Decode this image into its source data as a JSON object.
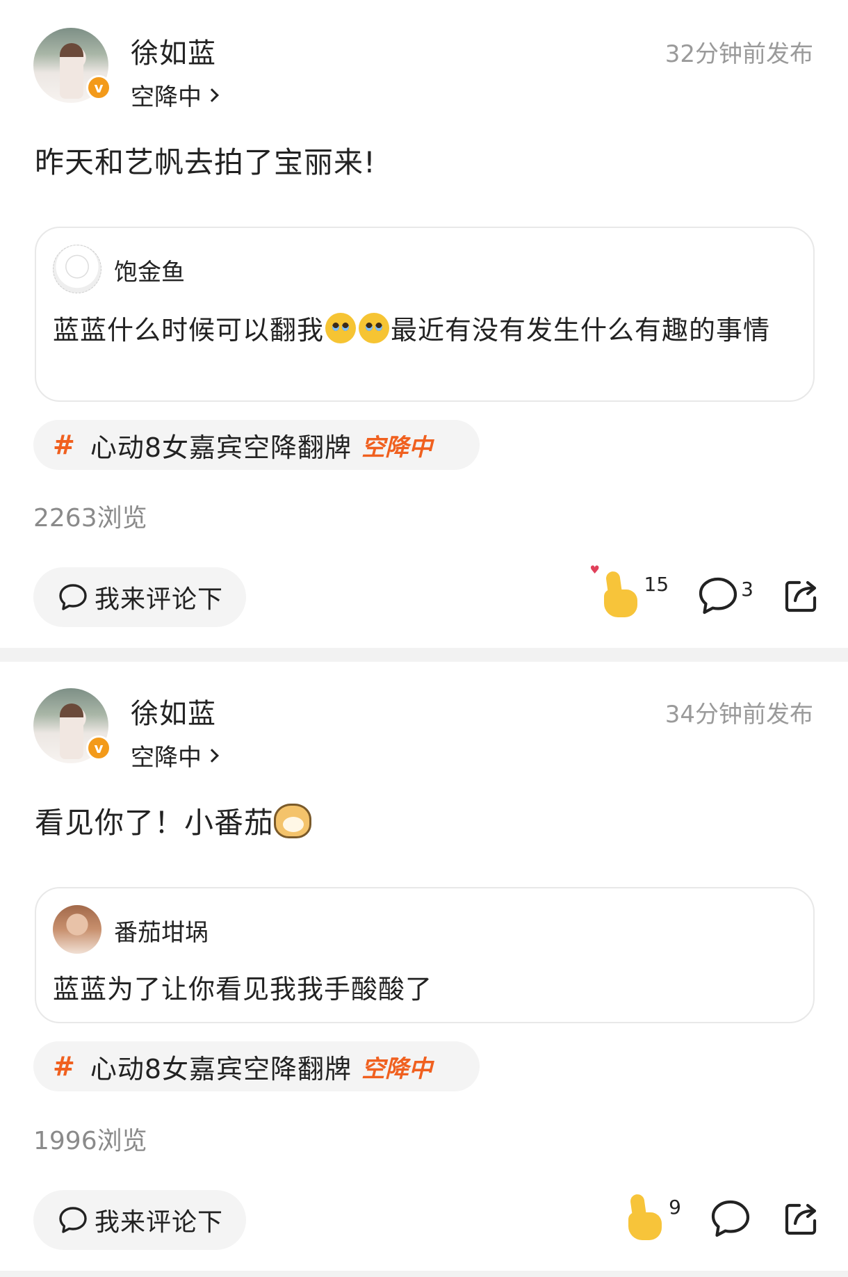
{
  "posts": [
    {
      "author": "徐如蓝",
      "status": "空降中",
      "timestamp": "32分钟前发布",
      "content": "昨天和艺帆去拍了宝丽来!",
      "quote": {
        "name": "饱金鱼",
        "text_before": "蓝蓝什么时候可以翻我",
        "text_after": "最近有没有发生什么有趣的事情"
      },
      "topic": {
        "hash": "#",
        "label": "心动8女嘉宾空降翻牌",
        "tag": "空降中"
      },
      "views": "2263浏览",
      "comment_button": "我来评论下",
      "likes": "15",
      "comments": "3"
    },
    {
      "author": "徐如蓝",
      "status": "空降中",
      "timestamp": "34分钟前发布",
      "content": "看见你了！小番茄",
      "quote": {
        "name": "番茄坩埚",
        "text": "蓝蓝为了让你看见我我手酸酸了"
      },
      "topic": {
        "hash": "#",
        "label": "心动8女嘉宾空降翻牌",
        "tag": "空降中"
      },
      "views": "1996浏览",
      "comment_button": "我来评论下",
      "likes": "9",
      "comments": ""
    }
  ],
  "colors": {
    "accent": "#f0601f",
    "verified": "#f39a1a",
    "muted": "#9a9a9a",
    "chip_bg": "#f4f4f4"
  },
  "icons": [
    "verified-badge-icon",
    "chevron-right-icon",
    "hash-icon",
    "comment-bubble-icon",
    "thumbs-up-icon",
    "share-icon",
    "pleading-face-emoji",
    "doge-emoji"
  ]
}
